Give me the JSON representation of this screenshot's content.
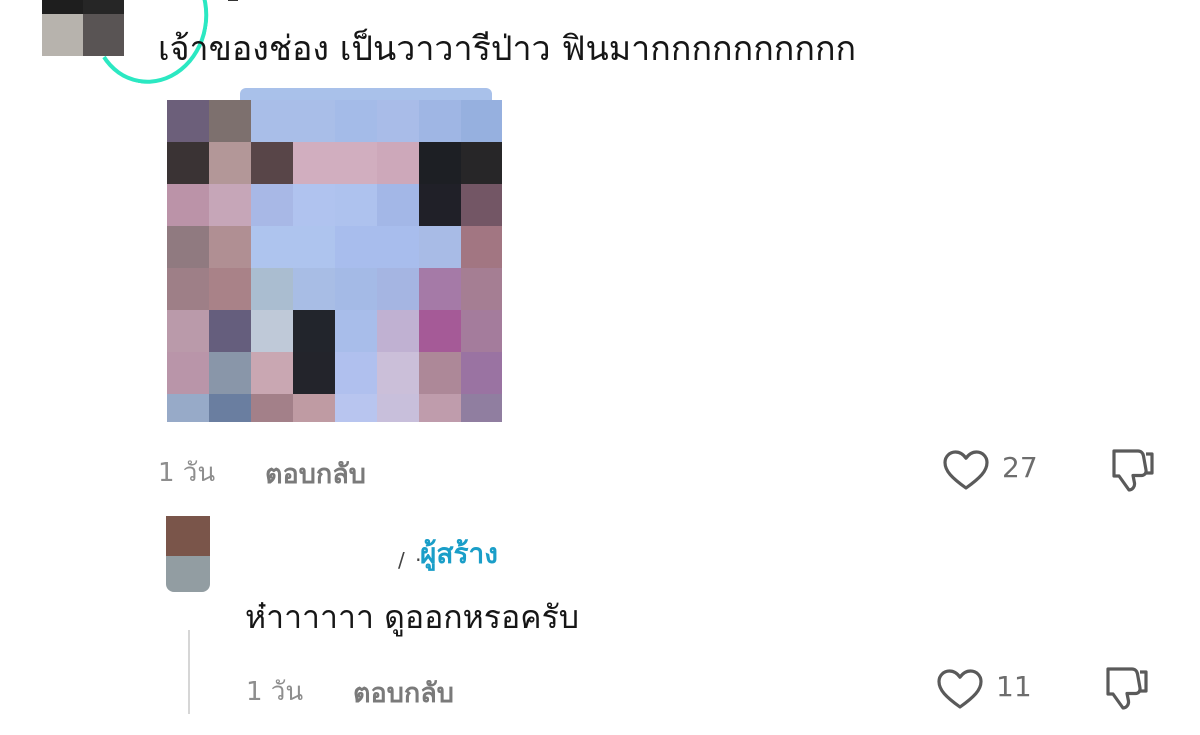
{
  "comment": {
    "text": "เจ้าของช่อง เป็นวาวารีป่าว ฟินมากกกกกกกกกก",
    "time": "1 วัน",
    "reply_label": "ตอบกลับ",
    "like_count": "27",
    "image_pixels": [
      [
        "#6c5f7a",
        "#7d706e",
        "#a9bee8",
        "#a9bee8",
        "#a4bbe8",
        "#a9bce8",
        "#9fb6e4",
        "#96b0df"
      ],
      [
        "#3a3334",
        "#b39798",
        "#584548",
        "#d1aebf",
        "#d1aebf",
        "#cda8ba",
        "#1d1f24",
        "#272628"
      ],
      [
        "#bb93a8",
        "#c6a6b8",
        "#a8b8e6",
        "#b0c3ef",
        "#aec2ee",
        "#a3b7e7",
        "#202028",
        "#735665"
      ],
      [
        "#907a80",
        "#b08f93",
        "#aec4ee",
        "#aec4ee",
        "#a8bded",
        "#a8bded",
        "#a8bbe6",
        "#a27682"
      ],
      [
        "#9e7f87",
        "#a98288",
        "#aabdd0",
        "#a8bde5",
        "#a4bae6",
        "#a5b5e2",
        "#a57aa7",
        "#a57e93"
      ],
      [
        "#ba9aaa",
        "#655e7d",
        "#bfc9d8",
        "#22252c",
        "#a8bdea",
        "#c0b1d2",
        "#a55a97",
        "#a47c9c"
      ],
      [
        "#b995a9",
        "#8996a9",
        "#c9a7b2",
        "#23242b",
        "#b0c0ee",
        "#cbbfd9",
        "#ad8898",
        "#9a73a2"
      ],
      [
        "#97aac8",
        "#6a7ea0",
        "#a38089",
        "#bf9ba3",
        "#b8c5ef",
        "#c8bfdb",
        "#bf9cac",
        "#907ea0"
      ]
    ]
  },
  "reply": {
    "author_badge": "ผู้สร้าง",
    "author_fragment": "/ ·",
    "text": "ห๋าาาาาา ดูออกหรอครับ",
    "time": "1 วัน",
    "reply_label": "ตอบกลับ",
    "like_count": "11"
  },
  "icons": {
    "like": "heart-outline-icon",
    "dislike": "thumbs-down-icon"
  },
  "colors": {
    "creator_badge": "#1a9ec8",
    "avatar_ring": "#2be8c2"
  }
}
